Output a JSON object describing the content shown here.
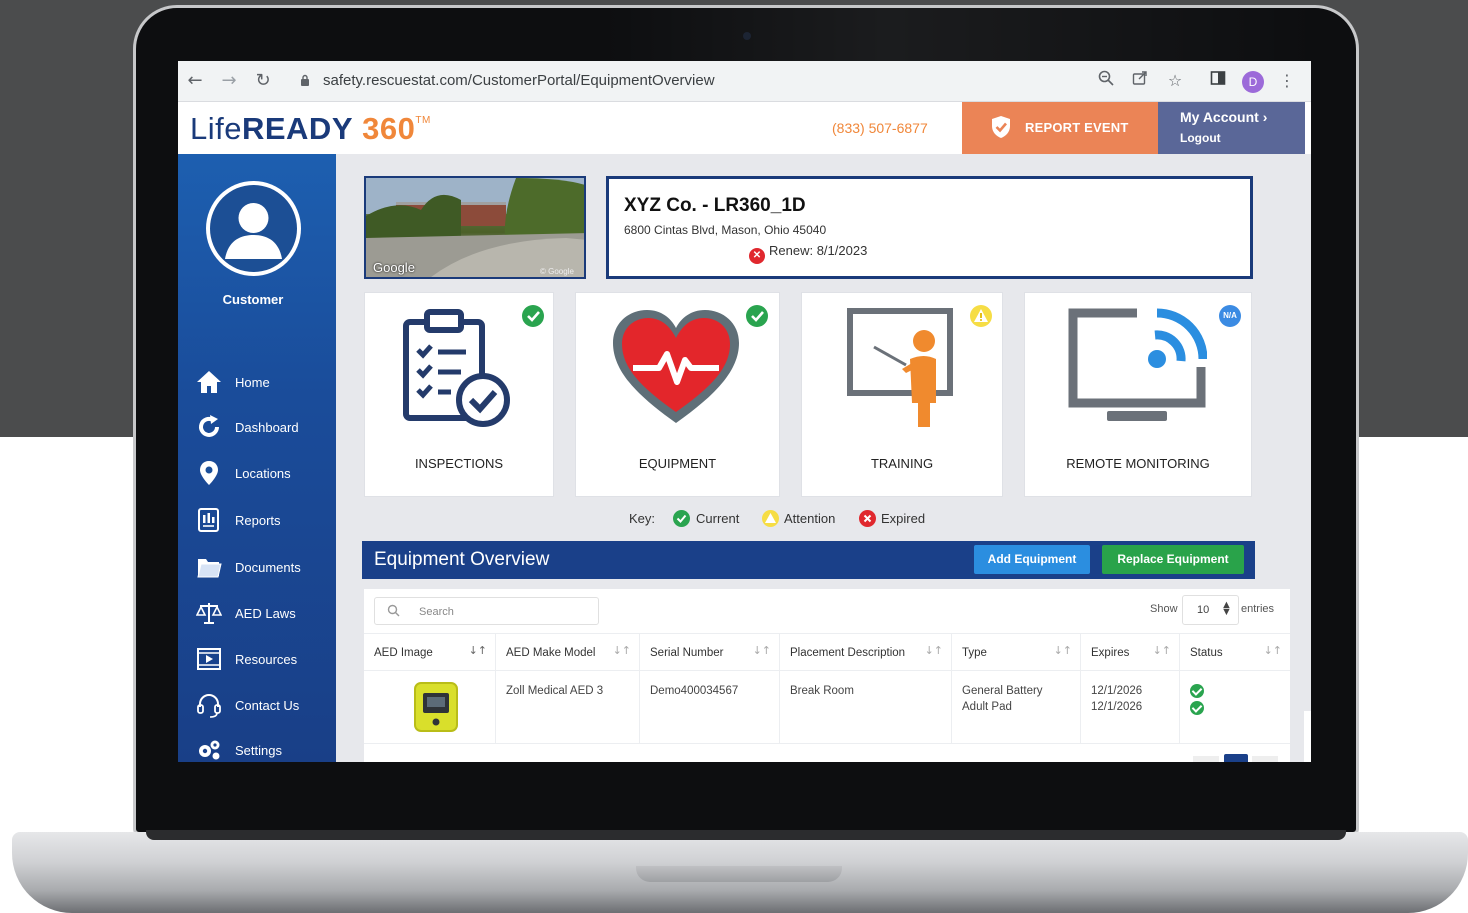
{
  "browser": {
    "url": "safety.rescuestat.com/CustomerPortal/EquipmentOverview",
    "profile_initial": "D"
  },
  "header": {
    "logo_part1": "Life",
    "logo_part2": "READY",
    "logo_part3": "360",
    "logo_tm": "TM",
    "phone": "(833) 507-6877",
    "report_event": "REPORT EVENT",
    "my_account": "My Account",
    "logout": "Logout"
  },
  "sidebar": {
    "role": "Customer",
    "items": [
      {
        "label": "Home",
        "icon": "home-icon"
      },
      {
        "label": "Dashboard",
        "icon": "refresh-icon"
      },
      {
        "label": "Locations",
        "icon": "location-pin-icon"
      },
      {
        "label": "Reports",
        "icon": "report-icon"
      },
      {
        "label": "Documents",
        "icon": "folder-icon"
      },
      {
        "label": "AED Laws",
        "icon": "scales-icon"
      },
      {
        "label": "Resources",
        "icon": "film-icon"
      },
      {
        "label": "Contact Us",
        "icon": "headset-icon"
      },
      {
        "label": "Settings",
        "icon": "gears-icon"
      }
    ]
  },
  "location": {
    "photo_credit": "Google",
    "photo_credit_small": "© Google",
    "name": "XYZ Co. - LR360_1D",
    "address": "6800 Cintas Blvd, Mason, Ohio 45040",
    "renew_label": "Renew:",
    "renew_date": "8/1/2023"
  },
  "cards": [
    {
      "label": "INSPECTIONS",
      "status": "current",
      "icon": "clipboard-check-icon"
    },
    {
      "label": "EQUIPMENT",
      "status": "current",
      "icon": "heart-pulse-icon"
    },
    {
      "label": "TRAINING",
      "status": "attention",
      "icon": "trainer-board-icon"
    },
    {
      "label": "REMOTE MONITORING",
      "status": "n/a",
      "badge_text": "N/A",
      "icon": "monitor-signal-icon"
    }
  ],
  "key": {
    "label": "Key:",
    "current": "Current",
    "attention": "Attention",
    "expired": "Expired"
  },
  "equipment_overview": {
    "title": "Equipment Overview",
    "add_button": "Add Equipment",
    "replace_button": "Replace Equipment",
    "search_placeholder": "Search",
    "show_label": "Show",
    "show_value": "10",
    "entries_label": "entries",
    "columns": [
      "AED Image",
      "AED Make Model",
      "Serial Number",
      "Placement Description",
      "Type",
      "Expires",
      "Status"
    ],
    "rows": [
      {
        "make_model": "Zoll Medical AED 3",
        "serial": "Demo400034567",
        "placement": "Break Room",
        "type_line1": "General Battery",
        "type_line2": "Adult Pad",
        "expires_line1": "12/1/2026",
        "expires_line2": "12/1/2026",
        "status": [
          "current",
          "current"
        ]
      }
    ]
  },
  "colors": {
    "brand_navy": "#1a3a7a",
    "brand_orange": "#f0873a",
    "report_orange": "#eb8456",
    "account_slate": "#5a6798",
    "ok_green": "#2aa44f",
    "warn_yellow": "#f6dd45",
    "expired_red": "#e0282e",
    "add_blue": "#2b8ee0",
    "replace_green": "#29a34a"
  }
}
